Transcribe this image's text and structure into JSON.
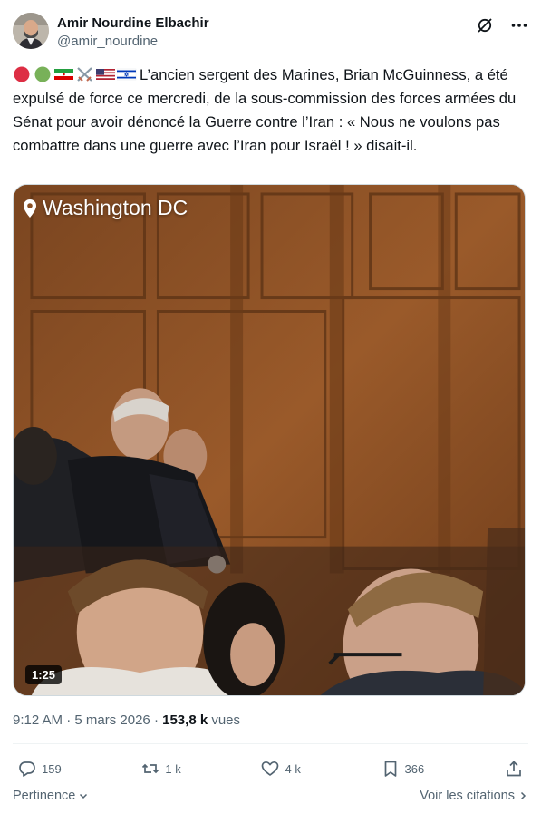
{
  "author": {
    "display_name": "Amir Nourdine Elbachir",
    "handle": "@amir_nourdine"
  },
  "header_icons": [
    "grok-icon",
    "more-icon"
  ],
  "tweet": {
    "emojis": [
      "red-circle",
      "green-circle",
      "iran-flag",
      "crossed-swords",
      "us-flag",
      "israel-flag"
    ],
    "text": "L’ancien sergent des Marines,  Brian McGuinness, a été expulsé de force ce mercredi, de la sous-commission des forces armées du Sénat pour avoir dénoncé la Guerre contre l’Iran : « Nous ne voulons pas combattre dans une guerre avec l’Iran pour Israël ! » disait-il."
  },
  "media": {
    "location": "Washington DC",
    "duration": "1:25"
  },
  "meta": {
    "time": "9:12 AM",
    "date": "5 mars 2026",
    "separator": "·",
    "views": "153,8 k",
    "views_label": "vues"
  },
  "actions": {
    "replies": "159",
    "reposts": "1 k",
    "likes": "4 k",
    "bookmarks": "366"
  },
  "footer": {
    "left": "Pertinence",
    "right": "Voir les citations"
  },
  "colors": {
    "text": "#0f1419",
    "secondary": "#536471",
    "divider": "#eff3f4"
  }
}
